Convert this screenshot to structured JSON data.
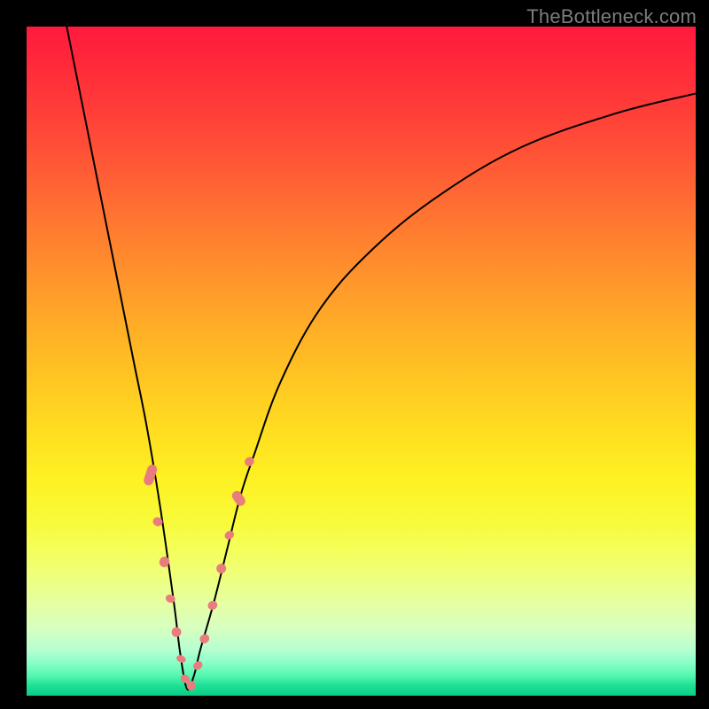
{
  "watermark": {
    "text": "TheBottleneck.com"
  },
  "colors": {
    "gradient_top": "#ff1a3d",
    "gradient_bottom": "#0acb86",
    "curve": "#000000",
    "marker": "#e97c7c",
    "frame": "#000000",
    "watermark": "#7c7c7c"
  },
  "chart_data": {
    "type": "line",
    "title": "",
    "xlabel": "",
    "ylabel": "",
    "xlim": [
      0,
      100
    ],
    "ylim": [
      0,
      100
    ],
    "grid": false,
    "legend": false,
    "annotations": [],
    "series": [
      {
        "name": "bottleneck-curve",
        "comment": "V-shaped bottleneck curve. x in 0-100 (share of plot width), y in 0-100 (0=bottom/green, 100=top/red). Minimum near x≈24.",
        "x": [
          6,
          8,
          10,
          12,
          14,
          16,
          18,
          20,
          22,
          23,
          24,
          25,
          26,
          28,
          30,
          32,
          34,
          38,
          44,
          52,
          62,
          74,
          88,
          100
        ],
        "y": [
          100,
          90,
          80,
          70,
          60,
          50,
          40,
          28,
          14,
          6,
          1,
          3,
          7,
          14,
          22,
          30,
          36,
          47,
          58,
          67,
          75,
          82,
          87,
          90
        ]
      }
    ],
    "markers": {
      "name": "highlighted-segments",
      "comment": "Pink rounded markers clustered along the lower V near the minimum.",
      "points": [
        {
          "x": 18.5,
          "y": 33,
          "len": 24,
          "angle": -72
        },
        {
          "x": 19.6,
          "y": 26,
          "len": 10,
          "angle": -72
        },
        {
          "x": 20.6,
          "y": 20,
          "len": 12,
          "angle": -72
        },
        {
          "x": 21.5,
          "y": 14.5,
          "len": 9,
          "angle": -72
        },
        {
          "x": 22.4,
          "y": 9.5,
          "len": 11,
          "angle": -70
        },
        {
          "x": 23.1,
          "y": 5.5,
          "len": 8,
          "angle": -66
        },
        {
          "x": 23.7,
          "y": 2.5,
          "len": 9,
          "angle": -50
        },
        {
          "x": 24.6,
          "y": 1.5,
          "len": 10,
          "angle": 20
        },
        {
          "x": 25.6,
          "y": 4.5,
          "len": 9,
          "angle": 55
        },
        {
          "x": 26.6,
          "y": 8.5,
          "len": 10,
          "angle": 60
        },
        {
          "x": 27.8,
          "y": 13.5,
          "len": 10,
          "angle": 62
        },
        {
          "x": 29.1,
          "y": 19,
          "len": 11,
          "angle": 60
        },
        {
          "x": 30.3,
          "y": 24,
          "len": 9,
          "angle": 58
        },
        {
          "x": 31.7,
          "y": 29.5,
          "len": 18,
          "angle": 56
        },
        {
          "x": 33.3,
          "y": 35,
          "len": 10,
          "angle": 52
        }
      ]
    }
  }
}
